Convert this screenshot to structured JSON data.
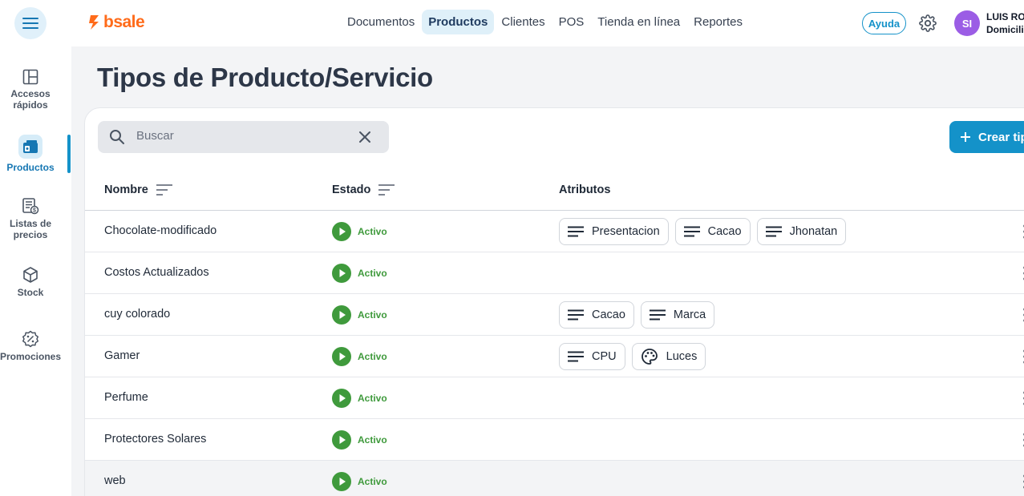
{
  "header": {
    "logo_text": "bsale",
    "nav": [
      {
        "label": "Documentos",
        "active": false
      },
      {
        "label": "Productos",
        "active": true
      },
      {
        "label": "Clientes",
        "active": false
      },
      {
        "label": "POS",
        "active": false
      },
      {
        "label": "Tienda en línea",
        "active": false
      },
      {
        "label": "Reportes",
        "active": false
      }
    ],
    "help_label": "Ayuda",
    "avatar_initials": "SI",
    "user_name": "LUIS RO",
    "user_sub": "Domicili"
  },
  "sidebar": {
    "items": [
      {
        "label_line1": "Accesos",
        "label_line2": "rápidos",
        "icon": "layout-icon",
        "active": false
      },
      {
        "label_line1": "Productos",
        "label_line2": "",
        "icon": "products-icon",
        "active": true
      },
      {
        "label_line1": "Listas de",
        "label_line2": "precios",
        "icon": "price-list-icon",
        "active": false
      },
      {
        "label_line1": "Stock",
        "label_line2": "",
        "icon": "box-icon",
        "active": false
      },
      {
        "label_line1": "Promociones",
        "label_line2": "",
        "icon": "promo-icon",
        "active": false
      }
    ]
  },
  "page": {
    "title": "Tipos de Producto/Servicio",
    "search_placeholder": "Buscar",
    "create_label": "Crear tip"
  },
  "table": {
    "columns": [
      "Nombre",
      "Estado",
      "Atributos"
    ],
    "rows": [
      {
        "name": "Chocolate-modificado",
        "status": "Activo",
        "attributes": [
          {
            "label": "Presentacion",
            "icon": "lines-icon"
          },
          {
            "label": "Cacao",
            "icon": "lines-icon"
          },
          {
            "label": "Jhonatan",
            "icon": "lines-icon"
          }
        ]
      },
      {
        "name": "Costos Actualizados",
        "status": "Activo",
        "attributes": []
      },
      {
        "name": "cuy colorado",
        "status": "Activo",
        "attributes": [
          {
            "label": "Cacao",
            "icon": "lines-icon"
          },
          {
            "label": "Marca",
            "icon": "lines-icon"
          }
        ]
      },
      {
        "name": "Gamer",
        "status": "Activo",
        "attributes": [
          {
            "label": "CPU",
            "icon": "lines-icon"
          },
          {
            "label": "Luces",
            "icon": "palette-icon"
          }
        ]
      },
      {
        "name": "Perfume",
        "status": "Activo",
        "attributes": []
      },
      {
        "name": "Protectores Solares",
        "status": "Activo",
        "attributes": []
      },
      {
        "name": "web",
        "status": "Activo",
        "attributes": []
      }
    ]
  },
  "colors": {
    "accent": "#1492c9",
    "brand": "#ff6b1a",
    "status_active": "#3f9a3c",
    "avatar": "#9b5de5"
  }
}
